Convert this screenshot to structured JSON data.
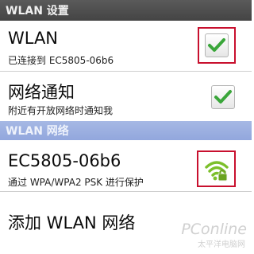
{
  "header": {
    "title": "WLAN 设置"
  },
  "settings": {
    "wlan": {
      "title": "WLAN",
      "subtitle": "已连接到 EC5805-06b6",
      "checked": true
    },
    "network_notify": {
      "title": "网络通知",
      "subtitle": "附近有开放网络时通知我",
      "checked": true
    }
  },
  "networks_header": {
    "title": "WLAN 网络"
  },
  "networks": [
    {
      "ssid": "EC5805-06b6",
      "security": "通过 WPA/WPA2 PSK 进行保护",
      "icon": "wifi-locked-icon"
    }
  ],
  "add_network": {
    "label": "添加 WLAN 网络"
  },
  "watermark": {
    "brand": "PConline",
    "sub": "太平洋电脑网"
  },
  "colors": {
    "check_green": "#3aa63a",
    "highlight_red": "#c8102e",
    "wifi_green": "#7cbf2b",
    "section_blue": "#9aaee0"
  }
}
